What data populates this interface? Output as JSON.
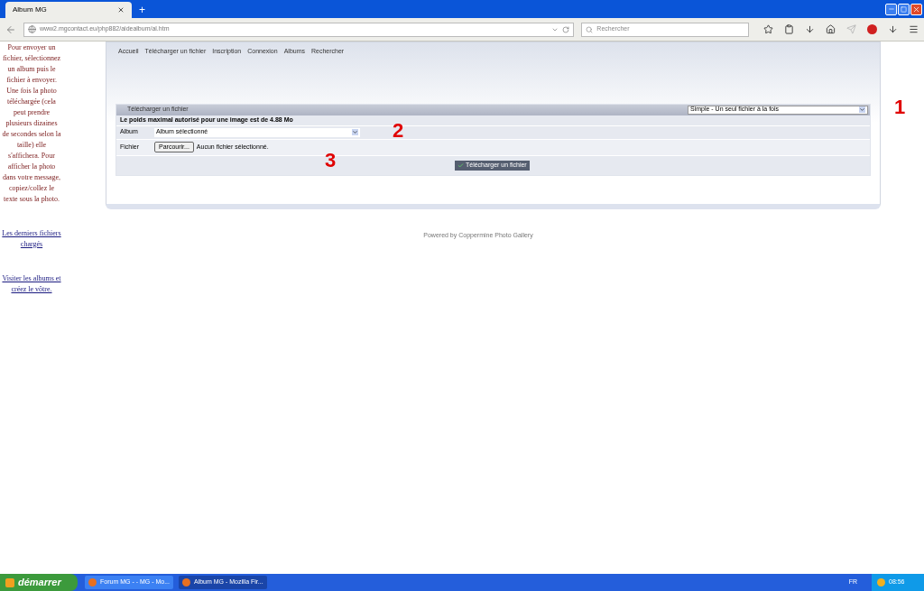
{
  "browser": {
    "tab_title": "Album MG",
    "new_tab": "+",
    "url": "www2.mgcontact.eu/php882/aidealbum/al.htm",
    "search_placeholder": "Rechercher"
  },
  "sidebar": {
    "instructions": "Pour envoyer un fichier, sélectionnez un album puis le fichier à envoyer. Une fois la photo téléchargée (cela peut prendre plusieurs dizaines de secondes selon la taille) elle s'affichera. Pour afficher la photo dans votre message, copiez/collez le texte sous la photo.",
    "links": [
      "Les derniers fichiers chargés",
      "Visiter les albums et créez le vôtre."
    ]
  },
  "nav": [
    "Accueil",
    "Télécharger un fichier",
    "Inscription",
    "Connexion",
    "Albums",
    "Rechercher"
  ],
  "upload": {
    "title": "Télécharger un fichier",
    "mode": "Simple - Un seul fichier à la fois",
    "max_size": "Le poids maximal autorisé pour une image est de 4.88 Mo",
    "album_label": "Album",
    "album_value": "Album sélectionné",
    "file_label": "Fichier",
    "browse": "Parcourir...",
    "file_status": "Aucun fichier sélectionné.",
    "submit": "Télécharger un fichier"
  },
  "annotations": [
    "1",
    "2",
    "3"
  ],
  "footer": "Powered by Coppermine Photo Gallery",
  "taskbar": {
    "start": "démarrer",
    "tasks": [
      {
        "label": "Forum MG - - MG - Mo...",
        "selected": false
      },
      {
        "label": "Album MG - Mozilla Fir...",
        "selected": true
      }
    ],
    "language": "FR",
    "clock": "08:56"
  }
}
